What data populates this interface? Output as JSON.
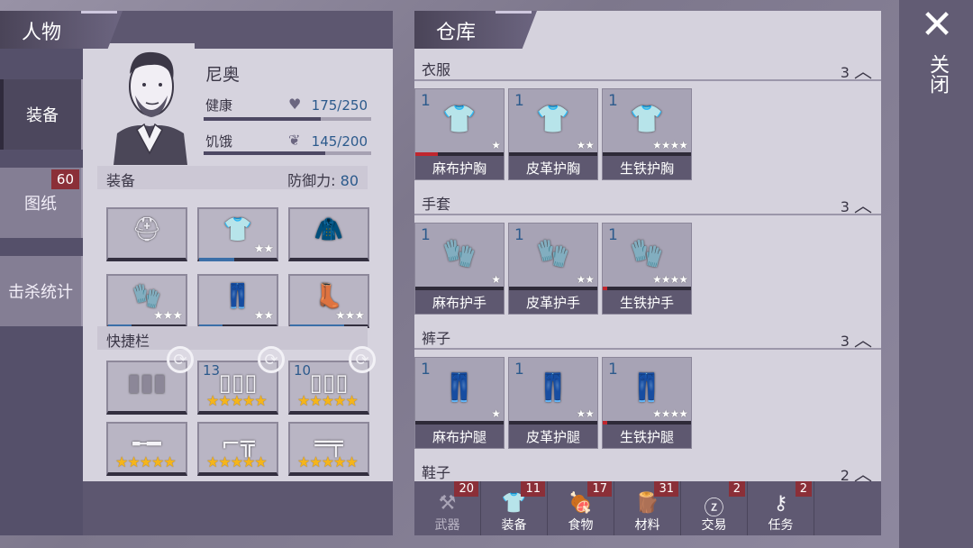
{
  "character_panel": {
    "title": "人物",
    "tabs": [
      {
        "label": "装备",
        "active": true
      },
      {
        "label": "图纸",
        "count": "60"
      },
      {
        "label": "击杀统计"
      }
    ],
    "name": "尼奥",
    "health": {
      "label": "健康",
      "value": "175/250",
      "fraction": 0.7
    },
    "hunger": {
      "label": "饥饿",
      "value": "145/200",
      "fraction": 0.725
    },
    "equipment": {
      "label": "装备",
      "defense_label": "防御力:",
      "defense_value": "80",
      "slots": [
        {
          "icon": "helmet-icon",
          "stars": 0,
          "durability": 0
        },
        {
          "icon": "chest-armor-icon",
          "stars": 2,
          "durability": 0.45
        },
        {
          "icon": "jacket-icon",
          "stars": 0,
          "durability": 0
        },
        {
          "icon": "gloves-icon",
          "stars": 3,
          "durability": 0.3
        },
        {
          "icon": "pants-icon",
          "stars": 2,
          "durability": 0.3
        },
        {
          "icon": "boots-icon",
          "stars": 3,
          "durability": 0.7
        }
      ]
    },
    "quickbar": {
      "label": "快捷栏",
      "slots": [
        {
          "icon": "ammo-icon",
          "count": "",
          "gold_stars": 0
        },
        {
          "icon": "shotgun-shells-icon",
          "count": "13",
          "gold_stars": 5
        },
        {
          "icon": "rifle-ammo-icon",
          "count": "10",
          "gold_stars": 5
        },
        {
          "icon": "shotgun-icon",
          "count": "",
          "gold_stars": 5
        },
        {
          "icon": "revolver-icon",
          "count": "",
          "gold_stars": 5
        },
        {
          "icon": "double-barrel-shotgun-icon",
          "count": "",
          "gold_stars": 5
        }
      ]
    }
  },
  "warehouse": {
    "title": "仓库",
    "categories": [
      {
        "name": "衣服",
        "count": "3",
        "items": [
          {
            "qty": "1",
            "label": "麻布护胸",
            "stars": 1,
            "red": 0.25
          },
          {
            "qty": "1",
            "label": "皮革护胸",
            "stars": 2,
            "red": 0
          },
          {
            "qty": "1",
            "label": "生铁护胸",
            "stars": 4,
            "red": 0
          }
        ]
      },
      {
        "name": "手套",
        "count": "3",
        "items": [
          {
            "qty": "1",
            "label": "麻布护手",
            "stars": 1,
            "red": 0
          },
          {
            "qty": "1",
            "label": "皮革护手",
            "stars": 2,
            "red": 0
          },
          {
            "qty": "1",
            "label": "生铁护手",
            "stars": 4,
            "red": 0.05
          }
        ]
      },
      {
        "name": "裤子",
        "count": "3",
        "items": [
          {
            "qty": "1",
            "label": "麻布护腿",
            "stars": 1,
            "red": 0
          },
          {
            "qty": "1",
            "label": "皮革护腿",
            "stars": 2,
            "red": 0
          },
          {
            "qty": "1",
            "label": "生铁护腿",
            "stars": 4,
            "red": 0.05
          }
        ]
      },
      {
        "name": "鞋子",
        "count": "2",
        "items": []
      }
    ],
    "bottom_tabs": [
      {
        "label": "武器",
        "badge": "20",
        "icon": "axe-icon",
        "dim": true
      },
      {
        "label": "装备",
        "badge": "11",
        "icon": "shirt-icon"
      },
      {
        "label": "食物",
        "badge": "17",
        "icon": "meat-icon"
      },
      {
        "label": "材料",
        "badge": "31",
        "icon": "wood-icon"
      },
      {
        "label": "交易",
        "badge": "2",
        "icon": "coin-icon"
      },
      {
        "label": "任务",
        "badge": "2",
        "icon": "key-icon"
      }
    ]
  },
  "close": {
    "label": "关闭"
  }
}
